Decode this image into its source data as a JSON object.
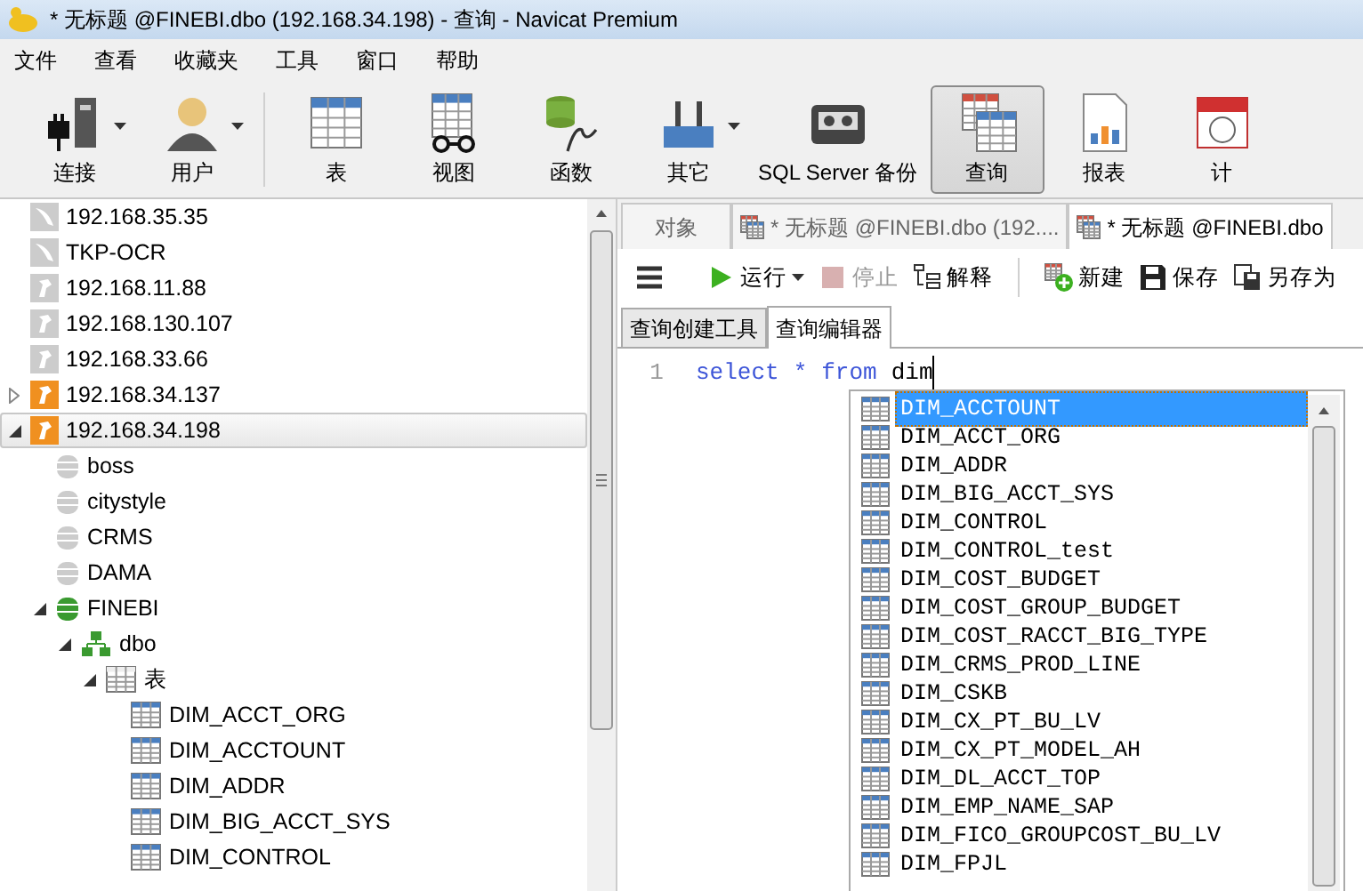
{
  "window": {
    "title": "* 无标题 @FINEBI.dbo (192.168.34.198) - 查询 - Navicat Premium"
  },
  "menu": [
    "文件",
    "查看",
    "收藏夹",
    "工具",
    "窗口",
    "帮助"
  ],
  "toolbar": [
    {
      "kind": "connect",
      "label": "连接",
      "dropdown": true,
      "selected": false
    },
    {
      "kind": "user",
      "label": "用户",
      "dropdown": true,
      "selected": false
    },
    {
      "kind": "table",
      "label": "表",
      "dropdown": false,
      "selected": false
    },
    {
      "kind": "view",
      "label": "视图",
      "dropdown": false,
      "selected": false
    },
    {
      "kind": "function",
      "label": "函数",
      "dropdown": false,
      "selected": false
    },
    {
      "kind": "other",
      "label": "其它",
      "dropdown": true,
      "selected": false
    },
    {
      "kind": "backup",
      "label": "SQL Server 备份",
      "dropdown": false,
      "selected": false
    },
    {
      "kind": "query",
      "label": "查询",
      "dropdown": false,
      "selected": true
    },
    {
      "kind": "report",
      "label": "报表",
      "dropdown": false,
      "selected": false
    },
    {
      "kind": "schedule",
      "label": "计",
      "dropdown": false,
      "selected": false
    }
  ],
  "tree": [
    {
      "kind": "mysql",
      "label": "192.168.35.35",
      "selected": false
    },
    {
      "kind": "mysql",
      "label": "TKP-OCR",
      "selected": false
    },
    {
      "kind": "server",
      "label": "192.168.11.88",
      "connected": false,
      "selected": false
    },
    {
      "kind": "server",
      "label": "192.168.130.107",
      "connected": false,
      "selected": false
    },
    {
      "kind": "server",
      "label": "192.168.33.66",
      "connected": false,
      "selected": false
    },
    {
      "kind": "server",
      "label": "192.168.34.137",
      "connected": true,
      "expanded": false,
      "selected": false
    },
    {
      "kind": "server",
      "label": "192.168.34.198",
      "connected": true,
      "expanded": true,
      "selected": true,
      "children": [
        {
          "kind": "database",
          "label": "boss",
          "open": false,
          "selected": false
        },
        {
          "kind": "database",
          "label": "citystyle",
          "open": false,
          "selected": false
        },
        {
          "kind": "database",
          "label": "CRMS",
          "open": false,
          "selected": false
        },
        {
          "kind": "database",
          "label": "DAMA",
          "open": false,
          "selected": false
        },
        {
          "kind": "database",
          "label": "FINEBI",
          "open": true,
          "expanded": true,
          "selected": false,
          "children": [
            {
              "kind": "schema",
              "label": "dbo",
              "expanded": true,
              "selected": false,
              "children": [
                {
                  "kind": "folder",
                  "label": "表",
                  "expanded": true,
                  "selected": false,
                  "children": [
                    {
                      "kind": "table",
                      "label": "DIM_ACCT_ORG",
                      "selected": false
                    },
                    {
                      "kind": "table",
                      "label": "DIM_ACCTOUNT",
                      "selected": false
                    },
                    {
                      "kind": "table",
                      "label": "DIM_ADDR",
                      "selected": false
                    },
                    {
                      "kind": "table",
                      "label": "DIM_BIG_ACCT_SYS",
                      "selected": false
                    },
                    {
                      "kind": "table",
                      "label": "DIM_CONTROL",
                      "selected": false
                    }
                  ]
                }
              ]
            }
          ]
        }
      ]
    }
  ],
  "tabs": [
    {
      "label": "对象",
      "icon": false,
      "selected": false
    },
    {
      "label": "* 无标题 @FINEBI.dbo (192....",
      "icon": true,
      "selected": false
    },
    {
      "label": "* 无标题 @FINEBI.dbo",
      "icon": true,
      "selected": true
    }
  ],
  "query_toolbar": [
    {
      "kind": "menu"
    },
    {
      "kind": "run",
      "label": "运行",
      "disabled": false,
      "dropdown": true
    },
    {
      "kind": "stop",
      "label": "停止",
      "disabled": true
    },
    {
      "kind": "explain",
      "label": "解释",
      "disabled": false
    },
    {
      "kind": "new",
      "label": "新建",
      "disabled": false
    },
    {
      "kind": "save",
      "label": "保存",
      "disabled": false
    },
    {
      "kind": "saveas",
      "label": "另存为",
      "disabled": false
    }
  ],
  "sub_tabs": [
    {
      "label": "查询创建工具",
      "selected": false
    },
    {
      "label": "查询编辑器",
      "selected": true
    }
  ],
  "editor": {
    "lines": [
      {
        "number": "1",
        "tokens": [
          {
            "text": "select",
            "kind": "keyword"
          },
          {
            "text": "*",
            "kind": "keyword"
          },
          {
            "text": "from",
            "kind": "keyword"
          },
          {
            "text": "dim",
            "kind": "identifier"
          }
        ]
      }
    ]
  },
  "autocomplete": [
    {
      "label": "DIM_ACCTOUNT",
      "selected": true
    },
    {
      "label": "DIM_ACCT_ORG",
      "selected": false
    },
    {
      "label": "DIM_ADDR",
      "selected": false
    },
    {
      "label": "DIM_BIG_ACCT_SYS",
      "selected": false
    },
    {
      "label": "DIM_CONTROL",
      "selected": false
    },
    {
      "label": "DIM_CONTROL_test",
      "selected": false
    },
    {
      "label": "DIM_COST_BUDGET",
      "selected": false
    },
    {
      "label": "DIM_COST_GROUP_BUDGET",
      "selected": false
    },
    {
      "label": "DIM_COST_RACCT_BIG_TYPE",
      "selected": false
    },
    {
      "label": "DIM_CRMS_PROD_LINE",
      "selected": false
    },
    {
      "label": "DIM_CSKB",
      "selected": false
    },
    {
      "label": "DIM_CX_PT_BU_LV",
      "selected": false
    },
    {
      "label": "DIM_CX_PT_MODEL_AH",
      "selected": false
    },
    {
      "label": "DIM_DL_ACCT_TOP",
      "selected": false
    },
    {
      "label": "DIM_EMP_NAME_SAP",
      "selected": false
    },
    {
      "label": "DIM_FICO_GROUPCOST_BU_LV",
      "selected": false
    },
    {
      "label": "DIM_FPJL",
      "selected": false
    }
  ]
}
